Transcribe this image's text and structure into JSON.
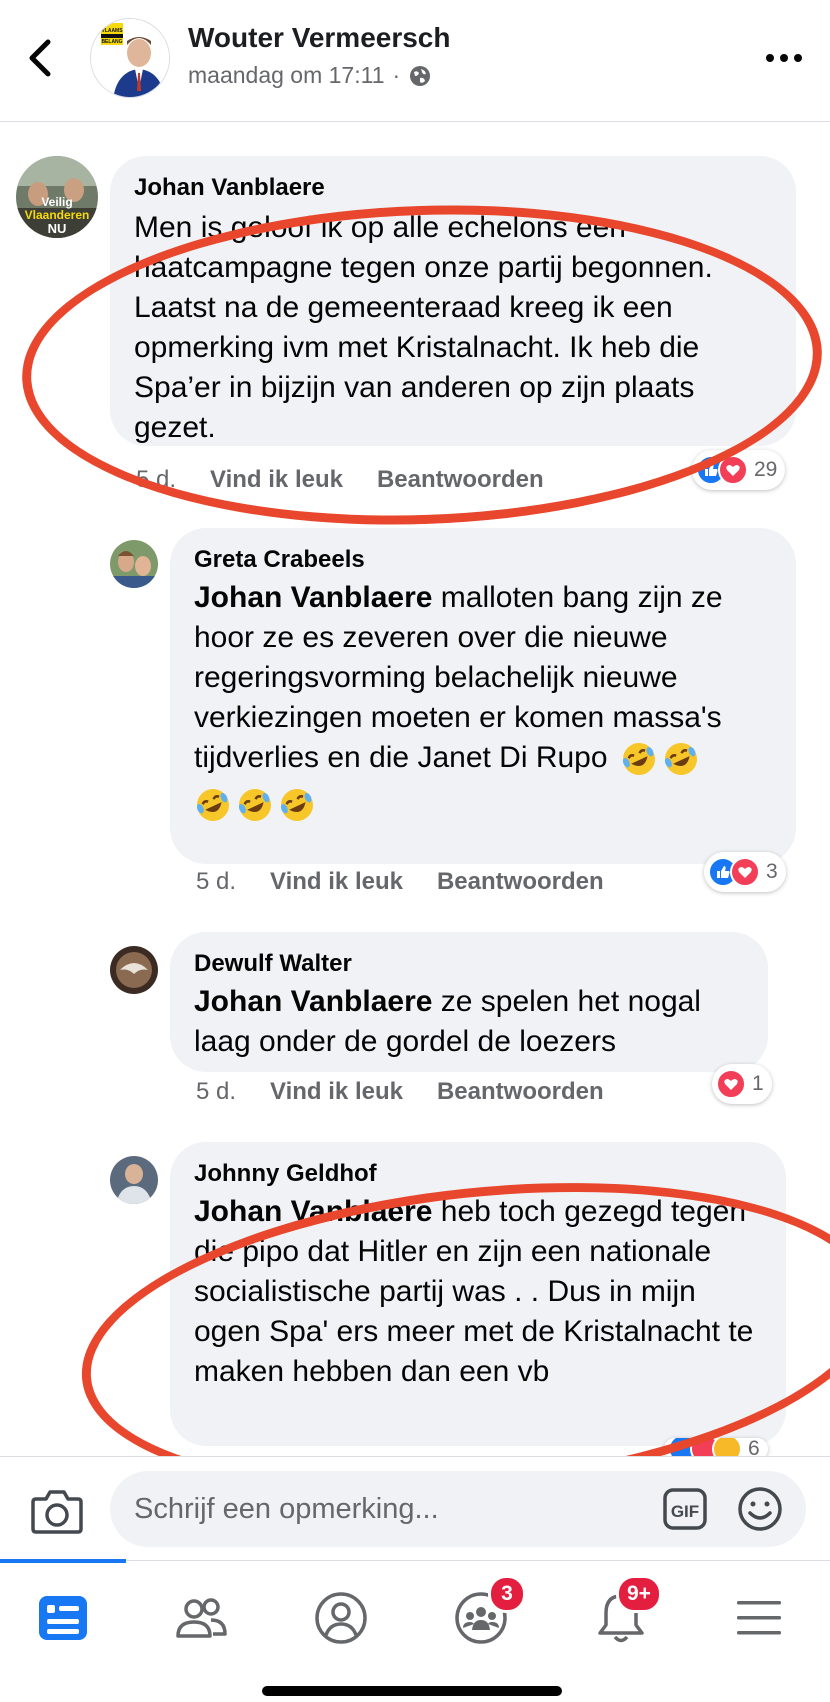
{
  "header": {
    "author": "Wouter Vermeersch",
    "timestamp": "maandag om 17:11",
    "separator": "·",
    "privacy_icon": "globe-icon",
    "avatar_badge_text": "VLAAMS BELANG"
  },
  "comments": [
    {
      "name": "Johan Vanblaere",
      "text": "Men is geloof ik op alle echelons een haatcampagne tegen onze partij begonnen. Laatst na de gemeenteraad kreeg ik een opmerking ivm met Kristalnacht. Ik heb die Spa’er in bijzijn van anderen op zijn plaats gezet.",
      "time": "5 d.",
      "like": "Vind ik leuk",
      "reply": "Beantwoorden",
      "reaction_count": "29",
      "avatar_text": "Veilig Vlaanderen NU"
    },
    {
      "name": "Greta Crabeels",
      "tag": "Johan Vanblaere",
      "text": " malloten bang zijn ze hoor ze es zeveren over die nieuwe regeringsvorming belachelijk nieuwe verkiezingen moeten er komen massa's tijdverlies en die Janet Di Rupo",
      "time": "5 d.",
      "like": "Vind ik leuk",
      "reply": "Beantwoorden",
      "reaction_count": "3",
      "emoji": "rolling-on-floor-laughing"
    },
    {
      "name": "Dewulf Walter",
      "tag": "Johan Vanblaere",
      "text": " ze spelen het nogal laag onder de gordel de loezers",
      "time": "5 d.",
      "like": "Vind ik leuk",
      "reply": "Beantwoorden",
      "reaction_count": "1"
    },
    {
      "name": "Johnny Geldhof",
      "tag": "Johan Vanblaere",
      "text": " heb toch gezegd tegen die pipo dat Hitler en zijn een nationale socialistische partij was . . Dus in mijn ogen Spa' ers meer met de Kristalnacht te maken hebben dan een vb",
      "reaction_count": "6"
    }
  ],
  "composer": {
    "placeholder": "Schrijf een opmerking...",
    "gif_label": "GIF"
  },
  "tabbar": {
    "groups_badge": "3",
    "notifications_badge": "9+"
  },
  "colors": {
    "accent": "#1877f2",
    "annotation_red": "#e8472d",
    "bubble": "#f0f2f5",
    "badge_red": "#e41e3f"
  }
}
